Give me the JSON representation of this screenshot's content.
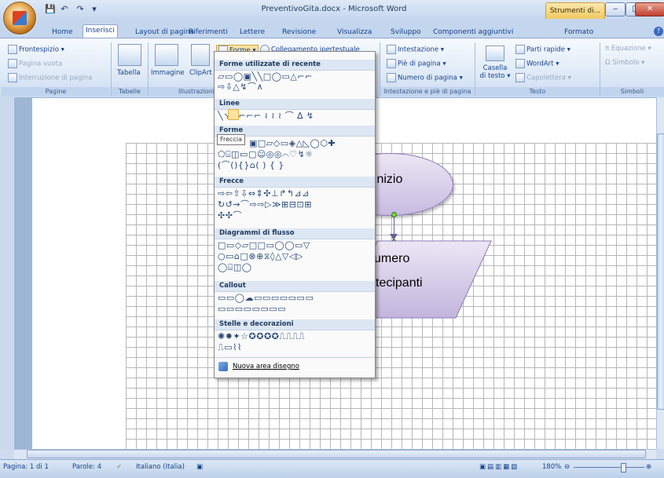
{
  "window": {
    "title": "PreventivoGita.docx - Microsoft Word",
    "contextual_tab": "Strumenti di...",
    "controls": [
      "‒",
      "□",
      "✕"
    ]
  },
  "quick_access": [
    "💾",
    "↶",
    "↷",
    "▾"
  ],
  "tabs": [
    "Home",
    "Inserisci",
    "Layout di pagina",
    "Riferimenti",
    "Lettere",
    "Revisione",
    "Visualizza",
    "Sviluppo",
    "Componenti aggiuntivi",
    "Formato"
  ],
  "active_tab": "Inserisci",
  "ribbon": {
    "pagine": {
      "label": "Pagine",
      "items": [
        "Frontespizio ▾",
        "Pagina vuota",
        "Interruzione di pagina"
      ]
    },
    "tabelle": {
      "label": "Tabelle",
      "button": "Tabella"
    },
    "illustrazioni": {
      "label": "Illustrazioni",
      "buttons": [
        "Immagine",
        "ClipArt"
      ],
      "forme": "Forme ▾"
    },
    "collegamenti": {
      "link": "Collegamento ipertestuale"
    },
    "intestazione": {
      "label": "Intestazione e piè di pagina",
      "items": [
        "Intestazione ▾",
        "Piè di pagina ▾",
        "Numero di pagina ▾"
      ]
    },
    "testo": {
      "label": "Testo",
      "casella": "Casella di testo ▾",
      "items": [
        "Parti rapide ▾",
        "WordArt ▾",
        "Capolettera ▾"
      ]
    },
    "simboli": {
      "label": "Simboli",
      "items": [
        "Equazione ▾",
        "Simbolo ▾"
      ]
    }
  },
  "shapes_menu": {
    "sections": [
      {
        "title": "Forme utilizzate di recente",
        "rows": [
          "▱▭◯▣╲╲□◯▭△⌐⌐",
          "⇨⇩△↯⌒∧"
        ]
      },
      {
        "title": "Linee",
        "rows": [
          "╲↘↖⌐⌐⌐ ≀ ≀ ≀ ⌒ ∆ ↯"
        ]
      },
      {
        "title": "Forme",
        "rows": [
          "▣□▱◇▭◈△◺◯⬡✚",
          "⬠⌸◫▭▢☺◎◎⌒♡↯☼",
          "(⌒(){}⌂( ) { }"
        ]
      },
      {
        "title": "Frecce",
        "rows": [
          "⇨⇦⇧⇩⇔⇕✣⊥↱↰⊿⊿",
          "↻↺⇝⌒⇨⇨▷≫⊞⊟⊡⊞",
          "✣✣⌒"
        ]
      },
      {
        "title": "Diagrammi di flusso",
        "rows": [
          "□▭◇▱□□▭◯◯▭▽",
          "○▭⌂□⊗⊕⧖◊△▽◁▷",
          "◯⌸◫◯"
        ]
      },
      {
        "title": "Callout",
        "rows": [
          "▭▭◯☁▭▭▭▭▭▭▭",
          "▭▭▭▭▭▭▭▭"
        ]
      },
      {
        "title": "Stelle e decorazioni",
        "rows": [
          "✺✹✦☆✪✪✪✪⎍⎍⎍⎍",
          "⎍▭⌇⌇"
        ]
      }
    ],
    "tooltip": "Freccia",
    "new_canvas": "Nuova area disegno"
  },
  "document": {
    "start_shape": "Inizio",
    "io_shape_line1": "umero",
    "io_shape_line2": "tecipanti"
  },
  "status": {
    "page": "Pagina: 1 di 1",
    "words": "Parole: 4",
    "language": "Italiano (Italia)",
    "zoom": "180%"
  },
  "colors": {
    "ribbon_bg": "#dbe7f6",
    "accent": "#15428b",
    "shape_fill": "#c7bbe0"
  }
}
